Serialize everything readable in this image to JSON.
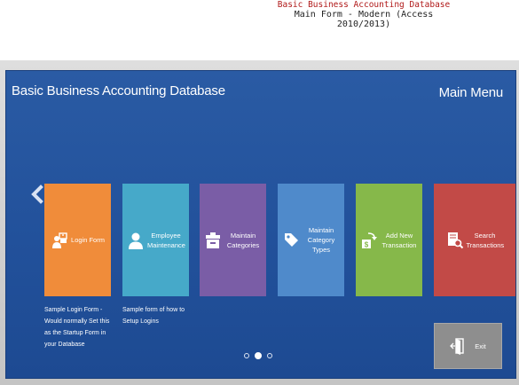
{
  "caption": {
    "title": "Basic Business Accounting Database",
    "subtitle": "Main Form - Modern (Access 2010/2013)"
  },
  "header": {
    "app_title": "Basic Business Accounting Database",
    "menu_title": "Main Menu"
  },
  "tiles": [
    {
      "label": "Login Form",
      "icon": "login-icon",
      "color": "#f08c3a"
    },
    {
      "label": "Employee Maintenance",
      "icon": "employee-icon",
      "color": "#46a9c9"
    },
    {
      "label": "Maintain Categories",
      "icon": "category-icon",
      "color": "#7a5da6"
    },
    {
      "label": "Maintain Category Types",
      "icon": "tag-icon",
      "color": "#4f8acb"
    },
    {
      "label": "Add New Transaction",
      "icon": "add-transaction-icon",
      "color": "#86b84a"
    },
    {
      "label": "Search Transactions",
      "icon": "search-transactions-icon",
      "color": "#c24a47"
    }
  ],
  "descriptions": [
    "Sample Login Form - Would normally Set this as the Startup Form in your Database",
    "Sample form of how to Setup Logins"
  ],
  "pager": {
    "pages": 3,
    "active_page": 2
  },
  "exit": {
    "label": "Exit",
    "icon": "exit-door-icon",
    "color": "#8e8e8e"
  },
  "colors": {
    "panel": "#2a5ba4",
    "frame": "#d0d0d0",
    "caption_title": "#b01818"
  }
}
